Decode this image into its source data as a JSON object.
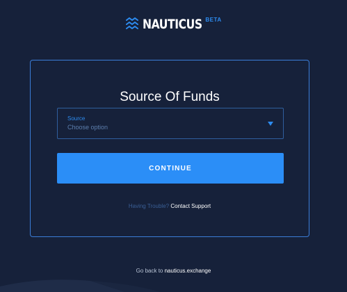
{
  "brand": {
    "name": "NAUTICUS",
    "badge": "BETA",
    "accent_color": "#2d8cf0",
    "logo_icon": "chevron-stack-icon"
  },
  "form": {
    "title": "Source Of Funds",
    "select": {
      "label": "Source",
      "placeholder": "Choose option",
      "icon": "caret-down-icon"
    },
    "continue_label": "CONTINUE",
    "button_color": "#2b8ef7"
  },
  "help": {
    "prompt": "Having Trouble?",
    "link_label": "Contact Support"
  },
  "footer": {
    "prefix": "Go back to",
    "link_label": "nauticus.exchange"
  },
  "colors": {
    "background": "#16213a",
    "card_border": "#3b7dd8"
  }
}
